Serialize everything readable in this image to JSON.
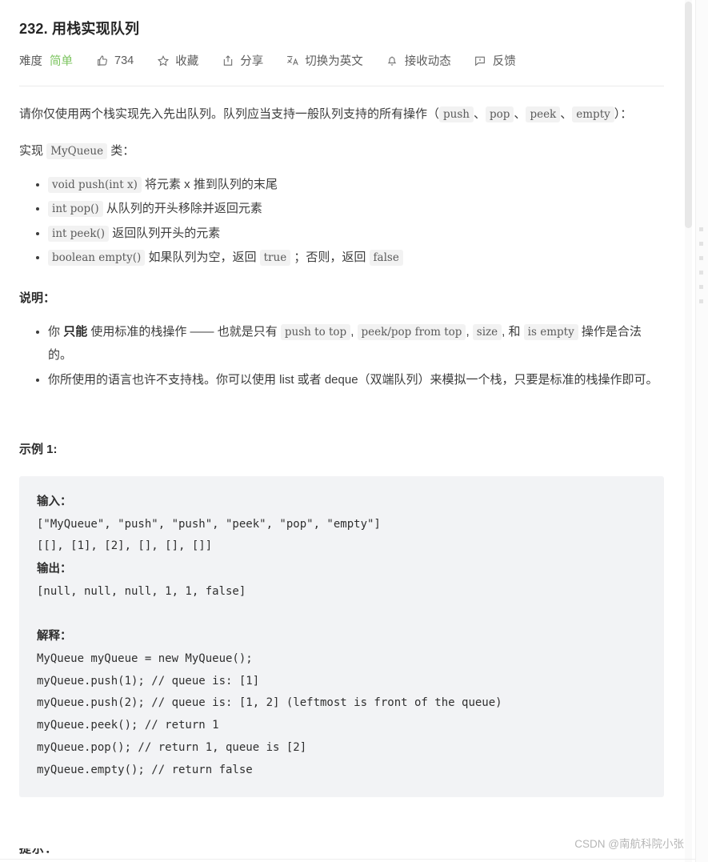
{
  "header": {
    "title": "232. 用栈实现队列",
    "difficulty_label": "难度",
    "difficulty_value": "简单",
    "difficulty_color": "#7cc45f",
    "likes": "734",
    "favorite": "收藏",
    "share": "分享",
    "switch_language": "切换为英文",
    "subscribe": "接收动态",
    "feedback": "反馈",
    "icons": {
      "like": "thumbs-up-icon",
      "favorite": "star-icon",
      "share": "share-icon",
      "translate": "translate-icon",
      "bell": "bell-icon",
      "feedback": "comment-icon"
    }
  },
  "description": {
    "p1_a": "请你仅使用两个栈实现先入先出队列。队列应当支持一般队列支持的所有操作（",
    "p1_code1": "push",
    "p1_b": "、",
    "p1_code2": "pop",
    "p1_c": "、",
    "p1_code3": "peek",
    "p1_d": "、",
    "p1_code4": "empty",
    "p1_e": "）：",
    "p2_a": "实现",
    "p2_code": "MyQueue",
    "p2_b": "类：",
    "methods": [
      {
        "code": "void push(int x)",
        "text": "将元素 x 推到队列的末尾"
      },
      {
        "code": "int pop()",
        "text": "从队列的开头移除并返回元素"
      },
      {
        "code": "int peek()",
        "text": "返回队列开头的元素"
      },
      {
        "code": "boolean empty()",
        "text_a": "如果队列为空，返回",
        "code_true": "true",
        "text_b": "；否则，返回",
        "code_false": "false"
      }
    ]
  },
  "notes": {
    "heading": "说明：",
    "b1_a": "你",
    "b1_bold": "只能",
    "b1_b": "使用标准的栈操作 —— 也就是只有",
    "b1_code1": "push to top",
    "b1_c": ",",
    "b1_code2": "peek/pop from top",
    "b1_d": ",",
    "b1_code3": "size",
    "b1_e": ", 和",
    "b1_code4": "is empty",
    "b1_f": "操作是合法的。",
    "b2": "你所使用的语言也许不支持栈。你可以使用 list 或者 deque（双端队列）来模拟一个栈，只要是标准的栈操作即可。"
  },
  "example": {
    "heading": "示例 1:",
    "input_label": "输入：",
    "input_line1": "[\"MyQueue\", \"push\", \"push\", \"peek\", \"pop\", \"empty\"]",
    "input_line2": "[[], [1], [2], [], [], []]",
    "output_label": "输出：",
    "output_line": "[null, null, null, 1, 1, false]",
    "explain_label": "解释：",
    "explain_lines": [
      "MyQueue myQueue = new MyQueue();",
      "myQueue.push(1); // queue is: [1]",
      "myQueue.push(2); // queue is: [1, 2] (leftmost is front of the queue)",
      "myQueue.peek(); // return 1",
      "myQueue.pop(); // return 1, queue is [2]",
      "myQueue.empty(); // return false"
    ]
  },
  "hints": {
    "heading": "提示："
  },
  "watermark": {
    "text": "CSDN @南航科院小张"
  }
}
